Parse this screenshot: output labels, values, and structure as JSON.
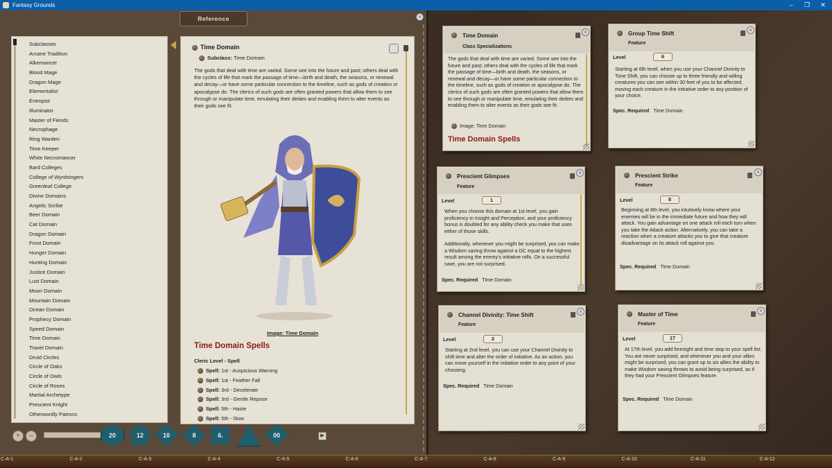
{
  "window": {
    "title": "Fantasy Grounds"
  },
  "reference": {
    "header": "Reference",
    "list": [
      "Subclasses",
      "Arcane Tradition",
      "Alkemancer",
      "Blood Mage",
      "Dragon Mage",
      "Elementalist",
      "Entropist",
      "Illuminator",
      "Master of Fiends",
      "Necrophage",
      "Ring Warden",
      "Time Keeper",
      "White Necromancer",
      "Bard Colleges",
      "College of Wyrdsingers",
      "Greenleaf College",
      "Divine Domains",
      "Angelic Scribe",
      "Beer Domain",
      "Cat Domain",
      "Dragon Domain",
      "Frost Domain",
      "Hunger Domain",
      "Hunting Domain",
      "Justice Domain",
      "Lust Domain",
      "Moon Domain",
      "Mountain Domain",
      "Ocean Domain",
      "Prophecy Domain",
      "Speed Domain",
      "Time Domain",
      "Travel Domain",
      "Druid Circles",
      "Circle of Oaks",
      "Circle of Owls",
      "Circle of Roses",
      "Martial Archetype",
      "Prescient Knight",
      "Otherwordly Patrons"
    ],
    "detail": {
      "title": "Time Domain",
      "subclass_label": "Subclass:",
      "subclass_value": "Time Domain",
      "description": "The gods that deal with time are varied. Some see into the future and past; others deal with the cycles of life that mark the passage of time—birth and death, the seasons, or renewal and decay—or have some particular connection to the timeline, such as gods of creation or apocalypse do. The clerics of such gods are often granted powers that allow them to see through or manipulate time, emulating their deities and enabling them to alter events as their gods see fit.",
      "image_caption": "Image: Time Domain",
      "spells_heading": "Time Domain Spells",
      "spells_sub": "Cleric Level - Spell",
      "spell_label": "Spell:",
      "spells": [
        "1st - Auspicious Warning",
        "1st - Feather Fall",
        "3rd - Decelerate",
        "3rd - Gentle Repose",
        "5th - Haste",
        "5th - Slow"
      ]
    }
  },
  "dice": [
    "20",
    "12",
    "10",
    "8",
    "6.",
    "",
    "00"
  ],
  "grid_labels": [
    "C-A-1",
    "C-A-2",
    "C-A-3",
    "C-A-4",
    "C-A-5",
    "C-A-6",
    "C-A-7",
    "C-A-8",
    "C-A-9",
    "C-A-10",
    "C-A-11",
    "C-A-12"
  ],
  "cards": {
    "time_domain": {
      "title": "Time Domain",
      "subtitle": "Class Specializations",
      "description": "The gods that deal with time are varied. Some see into the future and past; others deal with the cycles of life that mark the passage of time—birth and death, the seasons, or renewal and decay—or have some particular connection to the timeline, such as gods of creation or apocalypse do. The clerics of such gods are often granted powers that allow them to see through or manipulate time, emulating their deities and enabling them to alter events as their gods see fit.",
      "image_link": "Image: Time Domain",
      "spells_heading": "Time Domain Spells"
    },
    "group_time_shift": {
      "title": "Group Time Shift",
      "subtitle": "Feature",
      "level_label": "Level",
      "level": "6",
      "text": "Starting at 6th level, when you use your Channel Divinity to Time Shift, you can choose up to three friendly and willing creatures you can see within 30 feet of you to be affected, moving each creature in the initiative order to any position of your choice.",
      "spec_label": "Spec. Required",
      "spec_value": "Time Domain"
    },
    "prescient_glimpses": {
      "title": "Prescient Glimpses",
      "subtitle": "Feature",
      "level_label": "Level",
      "level": "1",
      "text1": "When you choose this domain at 1st level, you gain proficiency in Insight and Perception, and your proficiency bonus is doubled for any ability check you make that uses either of those skills.",
      "text2": "Additionally, whenever you might be surprised, you can make a Wisdom saving throw against a DC equal to the highest result among the enemy's initiative rolls. On a successful save, you are not surprised.",
      "spec_label": "Spec. Required",
      "spec_value": "Time Domain"
    },
    "prescient_strike": {
      "title": "Prescient Strike",
      "subtitle": "Feature",
      "level_label": "Level",
      "level": "8",
      "text": "Beginning at 8th level, you intuitively know where your enemies will be in the immediate future and how they will attack. You gain advantage on one attack roll each turn when you take the Attack action. Alternatively, you can take a reaction when a creature attacks you to give that creature disadvantage on its attack roll against you.",
      "spec_label": "Spec. Required",
      "spec_value": "Time Domain"
    },
    "channel_divinity": {
      "title": "Channel Divinity: Time Shift",
      "subtitle": "Feature",
      "level_label": "Level",
      "level": "2",
      "text": "Starting at 2nd level, you can use your Channel Divinity to shift time and alter the order of initiative. As an action, you can move yourself in the initiative order to any point of your choosing.",
      "spec_label": "Spec. Required",
      "spec_value": "Time Domain"
    },
    "master_of_time": {
      "title": "Master of Time",
      "subtitle": "Feature",
      "level_label": "Level",
      "level": "17",
      "text": "At 17th level, you add foresight and time stop to your spell list. You are never surprised, and whenever you and your allies might be surprised, you can grant up to six allies the ability to make Wisdom saving throws to avoid being surprised, as if they had your Prescient Glimpses feature.",
      "spec_label": "Spec. Required",
      "spec_value": "Time Domain"
    }
  },
  "icons": [
    "app-icon",
    "minimize-icon",
    "maximize-icon",
    "close-icon",
    "lock-icon",
    "link-bullet-icon",
    "play-icon",
    "add-icon",
    "remove-icon"
  ],
  "colors": {
    "title_bar": "#0b5ea8",
    "spell_heading": "#8b1a13",
    "paper": "#e7e2d6",
    "dice": "#1f5e6a",
    "gold_accent": "#c7a550"
  }
}
